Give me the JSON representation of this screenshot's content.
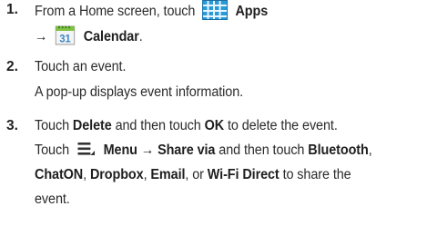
{
  "steps": [
    {
      "number": "1.",
      "line1_prefix": "From a Home screen, touch",
      "apps_label": "Apps",
      "line2_arrow": "→",
      "calendar_label": "Calendar",
      "calendar_icon_day": "31",
      "calendar_suffix": "."
    },
    {
      "number": "2.",
      "line1": "Touch an event.",
      "line2": "A pop-up displays event information."
    },
    {
      "number": "3.",
      "l1_a": "Touch",
      "l1_delete": "Delete",
      "l1_b": "and then touch",
      "l1_ok": "OK",
      "l1_c": "to delete the event.",
      "l2_a": "Touch",
      "l2_menu": "Menu",
      "l2_arrow": "→",
      "l2_share": "Share via",
      "l2_b": "and then touch",
      "l2_bluetooth": "Bluetooth",
      "l2_comma": ",",
      "l3_chaton": "ChatON",
      "l3_sep1": ",",
      "l3_dropbox": "Dropbox",
      "l3_sep2": ",",
      "l3_email": "Email",
      "l3_sep3": ", or",
      "l3_wifi": "Wi-Fi Direct",
      "l3_tail": "to share the",
      "l4": "event."
    }
  ],
  "colors": {
    "text": "#2b2b2b",
    "apps_icon_blue": "#2a9ad8",
    "calendar_green": "#7ec242",
    "calendar_day": "#3a86c8"
  },
  "icons": [
    "apps-grid-icon",
    "calendar-icon",
    "menu-icon"
  ]
}
